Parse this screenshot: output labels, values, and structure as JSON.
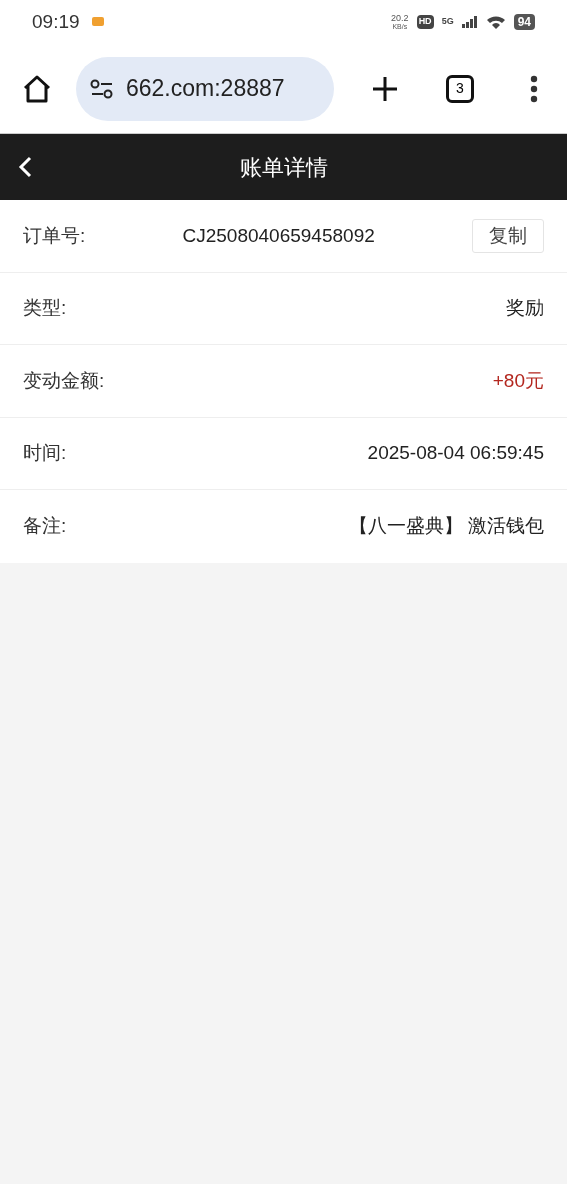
{
  "status_bar": {
    "time": "09:19",
    "speed": "20.2",
    "speed_unit": "KB/s",
    "hd": "HD",
    "network": "5G",
    "battery": "94"
  },
  "browser": {
    "url": "662.com:28887",
    "tab_count": "3"
  },
  "header": {
    "title": "账单详情"
  },
  "rows": [
    {
      "label": "订单号:",
      "value": "CJ2508040659458092",
      "highlight": false,
      "action": "复制"
    },
    {
      "label": "类型:",
      "value": "奖励",
      "highlight": false
    },
    {
      "label": "变动金额:",
      "value": "+80元",
      "highlight": true
    },
    {
      "label": "时间:",
      "value": "2025-08-04 06:59:45",
      "highlight": false
    },
    {
      "label": "备注:",
      "value": "【八一盛典】 激活钱包",
      "highlight": false
    }
  ]
}
